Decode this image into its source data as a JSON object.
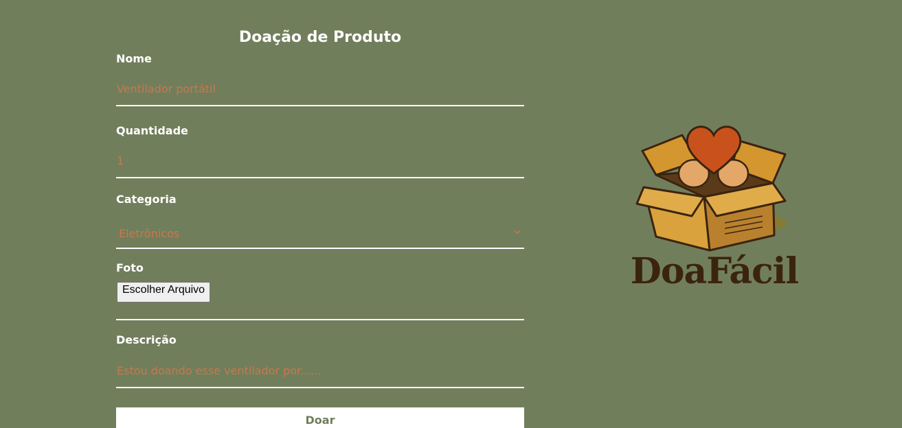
{
  "form": {
    "title": "Doação de Produto",
    "fields": {
      "nome": {
        "label": "Nome",
        "placeholder": "Ventilador portátil"
      },
      "quantidade": {
        "label": "Quantidade",
        "placeholder": "1"
      },
      "categoria": {
        "label": "Categoria",
        "selected": "Eletrônicos"
      },
      "foto": {
        "label": "Foto",
        "button": "Escolher Arquivo"
      },
      "descricao": {
        "label": "Descrição",
        "placeholder": "Estou doando esse ventilador por......"
      }
    },
    "submit_label": "Doar"
  },
  "logo": {
    "text": "DoaFácil",
    "icon": "box-with-heart-icon"
  },
  "colors": {
    "background": "#717e5c",
    "accent": "#c8784a",
    "text": "#ffffff",
    "logo_text": "#3a2410"
  }
}
